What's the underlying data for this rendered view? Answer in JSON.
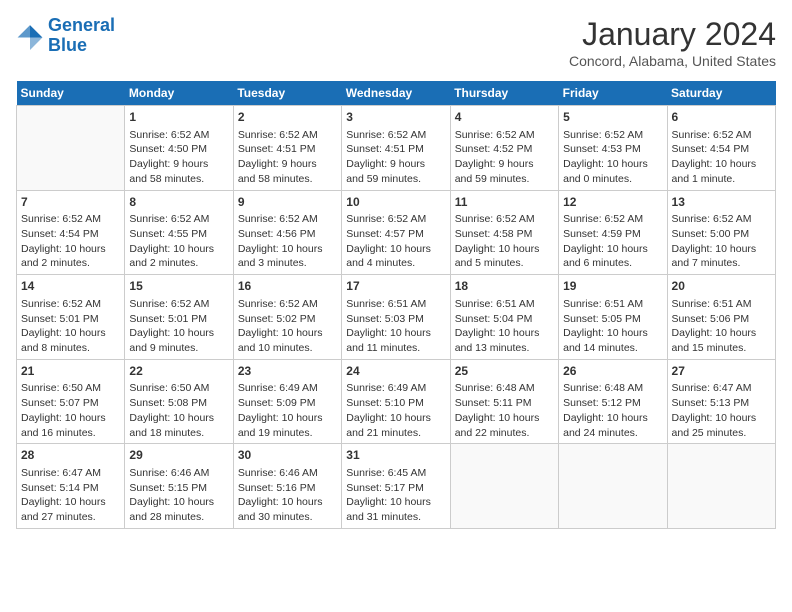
{
  "logo": {
    "line1": "General",
    "line2": "Blue"
  },
  "title": "January 2024",
  "subtitle": "Concord, Alabama, United States",
  "weekdays": [
    "Sunday",
    "Monday",
    "Tuesday",
    "Wednesday",
    "Thursday",
    "Friday",
    "Saturday"
  ],
  "weeks": [
    [
      {
        "day": "",
        "info": ""
      },
      {
        "day": "1",
        "info": "Sunrise: 6:52 AM\nSunset: 4:50 PM\nDaylight: 9 hours\nand 58 minutes."
      },
      {
        "day": "2",
        "info": "Sunrise: 6:52 AM\nSunset: 4:51 PM\nDaylight: 9 hours\nand 58 minutes."
      },
      {
        "day": "3",
        "info": "Sunrise: 6:52 AM\nSunset: 4:51 PM\nDaylight: 9 hours\nand 59 minutes."
      },
      {
        "day": "4",
        "info": "Sunrise: 6:52 AM\nSunset: 4:52 PM\nDaylight: 9 hours\nand 59 minutes."
      },
      {
        "day": "5",
        "info": "Sunrise: 6:52 AM\nSunset: 4:53 PM\nDaylight: 10 hours\nand 0 minutes."
      },
      {
        "day": "6",
        "info": "Sunrise: 6:52 AM\nSunset: 4:54 PM\nDaylight: 10 hours\nand 1 minute."
      }
    ],
    [
      {
        "day": "7",
        "info": "Sunrise: 6:52 AM\nSunset: 4:54 PM\nDaylight: 10 hours\nand 2 minutes."
      },
      {
        "day": "8",
        "info": "Sunrise: 6:52 AM\nSunset: 4:55 PM\nDaylight: 10 hours\nand 2 minutes."
      },
      {
        "day": "9",
        "info": "Sunrise: 6:52 AM\nSunset: 4:56 PM\nDaylight: 10 hours\nand 3 minutes."
      },
      {
        "day": "10",
        "info": "Sunrise: 6:52 AM\nSunset: 4:57 PM\nDaylight: 10 hours\nand 4 minutes."
      },
      {
        "day": "11",
        "info": "Sunrise: 6:52 AM\nSunset: 4:58 PM\nDaylight: 10 hours\nand 5 minutes."
      },
      {
        "day": "12",
        "info": "Sunrise: 6:52 AM\nSunset: 4:59 PM\nDaylight: 10 hours\nand 6 minutes."
      },
      {
        "day": "13",
        "info": "Sunrise: 6:52 AM\nSunset: 5:00 PM\nDaylight: 10 hours\nand 7 minutes."
      }
    ],
    [
      {
        "day": "14",
        "info": "Sunrise: 6:52 AM\nSunset: 5:01 PM\nDaylight: 10 hours\nand 8 minutes."
      },
      {
        "day": "15",
        "info": "Sunrise: 6:52 AM\nSunset: 5:01 PM\nDaylight: 10 hours\nand 9 minutes."
      },
      {
        "day": "16",
        "info": "Sunrise: 6:52 AM\nSunset: 5:02 PM\nDaylight: 10 hours\nand 10 minutes."
      },
      {
        "day": "17",
        "info": "Sunrise: 6:51 AM\nSunset: 5:03 PM\nDaylight: 10 hours\nand 11 minutes."
      },
      {
        "day": "18",
        "info": "Sunrise: 6:51 AM\nSunset: 5:04 PM\nDaylight: 10 hours\nand 13 minutes."
      },
      {
        "day": "19",
        "info": "Sunrise: 6:51 AM\nSunset: 5:05 PM\nDaylight: 10 hours\nand 14 minutes."
      },
      {
        "day": "20",
        "info": "Sunrise: 6:51 AM\nSunset: 5:06 PM\nDaylight: 10 hours\nand 15 minutes."
      }
    ],
    [
      {
        "day": "21",
        "info": "Sunrise: 6:50 AM\nSunset: 5:07 PM\nDaylight: 10 hours\nand 16 minutes."
      },
      {
        "day": "22",
        "info": "Sunrise: 6:50 AM\nSunset: 5:08 PM\nDaylight: 10 hours\nand 18 minutes."
      },
      {
        "day": "23",
        "info": "Sunrise: 6:49 AM\nSunset: 5:09 PM\nDaylight: 10 hours\nand 19 minutes."
      },
      {
        "day": "24",
        "info": "Sunrise: 6:49 AM\nSunset: 5:10 PM\nDaylight: 10 hours\nand 21 minutes."
      },
      {
        "day": "25",
        "info": "Sunrise: 6:48 AM\nSunset: 5:11 PM\nDaylight: 10 hours\nand 22 minutes."
      },
      {
        "day": "26",
        "info": "Sunrise: 6:48 AM\nSunset: 5:12 PM\nDaylight: 10 hours\nand 24 minutes."
      },
      {
        "day": "27",
        "info": "Sunrise: 6:47 AM\nSunset: 5:13 PM\nDaylight: 10 hours\nand 25 minutes."
      }
    ],
    [
      {
        "day": "28",
        "info": "Sunrise: 6:47 AM\nSunset: 5:14 PM\nDaylight: 10 hours\nand 27 minutes."
      },
      {
        "day": "29",
        "info": "Sunrise: 6:46 AM\nSunset: 5:15 PM\nDaylight: 10 hours\nand 28 minutes."
      },
      {
        "day": "30",
        "info": "Sunrise: 6:46 AM\nSunset: 5:16 PM\nDaylight: 10 hours\nand 30 minutes."
      },
      {
        "day": "31",
        "info": "Sunrise: 6:45 AM\nSunset: 5:17 PM\nDaylight: 10 hours\nand 31 minutes."
      },
      {
        "day": "",
        "info": ""
      },
      {
        "day": "",
        "info": ""
      },
      {
        "day": "",
        "info": ""
      }
    ]
  ]
}
